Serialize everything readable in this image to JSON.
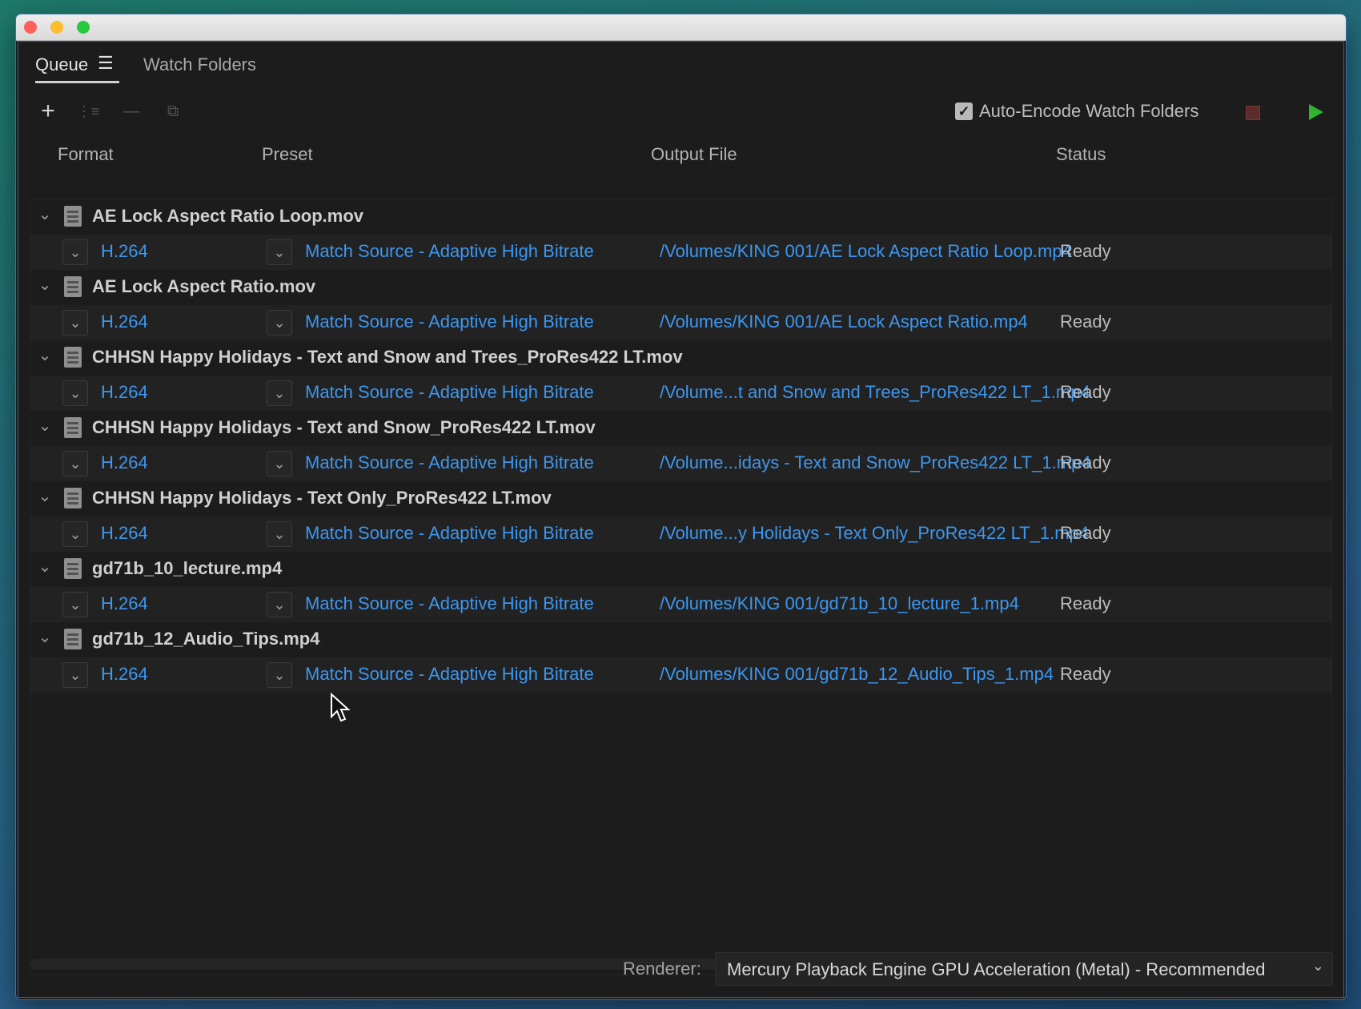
{
  "tabs": {
    "queue": "Queue",
    "queue_menu_icon": "hamburger-menu-icon",
    "watch_folders": "Watch Folders"
  },
  "toolbar": {
    "auto_encode_label": "Auto-Encode Watch Folders",
    "auto_encode_checked": true
  },
  "headers": {
    "format": "Format",
    "preset": "Preset",
    "output": "Output File",
    "status": "Status"
  },
  "items": [
    {
      "name": "AE Lock Aspect Ratio Loop.mov",
      "format": "H.264",
      "preset": "Match Source - Adaptive High Bitrate",
      "output": "/Volumes/KING 001/AE Lock Aspect Ratio Loop.mp4",
      "status": "Ready"
    },
    {
      "name": "AE Lock Aspect Ratio.mov",
      "format": "H.264",
      "preset": "Match Source - Adaptive High Bitrate",
      "output": "/Volumes/KING 001/AE Lock Aspect Ratio.mp4",
      "status": "Ready"
    },
    {
      "name": "CHHSN Happy Holidays - Text and Snow and Trees_ProRes422 LT.mov",
      "format": "H.264",
      "preset": "Match Source - Adaptive High Bitrate",
      "output": "/Volume...t and Snow and Trees_ProRes422 LT_1.mp4",
      "status": "Ready"
    },
    {
      "name": "CHHSN Happy Holidays - Text and Snow_ProRes422 LT.mov",
      "format": "H.264",
      "preset": "Match Source - Adaptive High Bitrate",
      "output": "/Volume...idays - Text and Snow_ProRes422 LT_1.mp4",
      "status": "Ready"
    },
    {
      "name": "CHHSN Happy Holidays - Text Only_ProRes422 LT.mov",
      "format": "H.264",
      "preset": "Match Source - Adaptive High Bitrate",
      "output": "/Volume...y Holidays - Text Only_ProRes422 LT_1.mp4",
      "status": "Ready"
    },
    {
      "name": "gd71b_10_lecture.mp4",
      "format": "H.264",
      "preset": "Match Source - Adaptive High Bitrate",
      "output": "/Volumes/KING 001/gd71b_10_lecture_1.mp4",
      "status": "Ready"
    },
    {
      "name": "gd71b_12_Audio_Tips.mp4",
      "format": "H.264",
      "preset": "Match Source - Adaptive High Bitrate",
      "output": "/Volumes/KING 001/gd71b_12_Audio_Tips_1.mp4",
      "status": "Ready"
    }
  ],
  "footer": {
    "renderer_label": "Renderer:",
    "renderer_value": "Mercury Playback Engine GPU Acceleration (Metal) - Recommended"
  },
  "colors": {
    "link_blue": "#3d97f0",
    "play_green": "#2fb52f",
    "stop_red": "#5c2b2b"
  }
}
